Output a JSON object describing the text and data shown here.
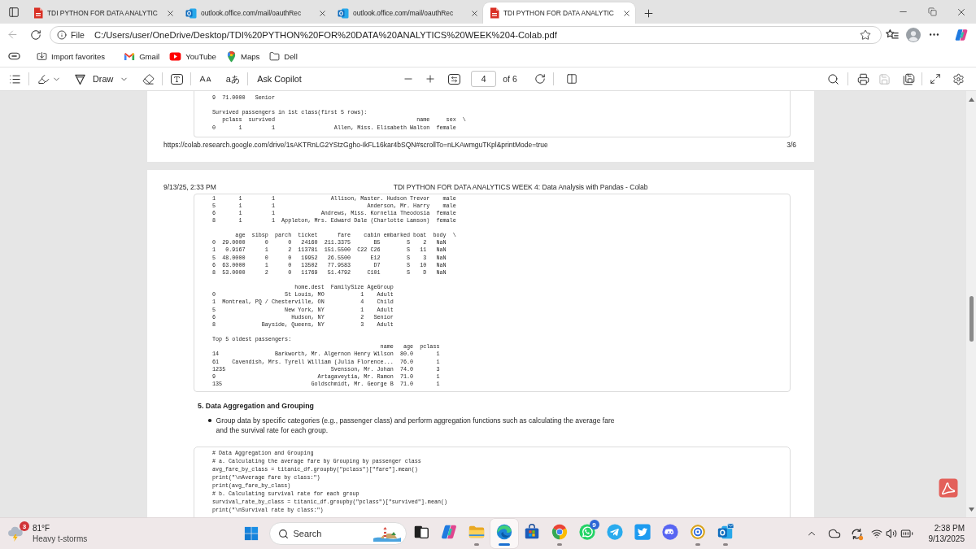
{
  "tabs": [
    {
      "title": "TDI PYTHON FOR DATA ANALYTIC",
      "kind": "pdf",
      "selected": false
    },
    {
      "title": "outlook.office.com/mail/oauthRec",
      "kind": "outlook",
      "selected": false
    },
    {
      "title": "outlook.office.com/mail/oauthRec",
      "kind": "outlook",
      "selected": false
    },
    {
      "title": "TDI PYTHON FOR DATA ANALYTIC",
      "kind": "pdf",
      "selected": true
    }
  ],
  "address_bar": {
    "back_disabled": true,
    "scheme": "File",
    "url": "C:/Users/user/OneDrive/Desktop/TDI%20PYTHON%20FOR%20DATA%20ANALYTICS%20WEEK%204-Colab.pdf"
  },
  "favorites_bar": [
    {
      "label": "Import favorites",
      "kind": "import"
    },
    {
      "label": "Gmail",
      "kind": "gmail"
    },
    {
      "label": "YouTube",
      "kind": "youtube"
    },
    {
      "label": "Maps",
      "kind": "maps"
    },
    {
      "label": "Dell",
      "kind": "folder"
    }
  ],
  "pdf_toolbar": {
    "draw_label": "Draw",
    "translate_glyph": "aあ",
    "ask_copilot": "Ask Copilot",
    "page_number": "4",
    "page_count": "of 6",
    "save_disabled": true
  },
  "document": {
    "page_3": {
      "output_blocks": [
        [
          "9  71.0000   Senior"
        ],
        [
          "Survived passengers in 1st class(first 5 rows):",
          "   pclass  survived                                           name     sex  \\",
          "0       1         1                  Allen, Miss. Elisabeth Walton  female"
        ]
      ],
      "footer_url": "https://colab.research.google.com/drive/1sAKTRnLG2YStzGgho-IkFL16kar4bSQN#scrollTo=nLKAwmguTKpl&printMode=true",
      "footer_page": "3/6"
    },
    "page_4": {
      "header_date": "9/13/25, 2:33 PM",
      "header_title": "TDI PYTHON FOR DATA ANALYTICS WEEK 4: Data Analysis with Pandas - Colab",
      "output_blocks": [
        [
          "1       1         1                 Allison, Master. Hudson Trevor    male",
          "5       1         1                            Anderson, Mr. Harry    male",
          "6       1         1              Andrews, Miss. Kornelia Theodosia  female",
          "8       1         1  Appleton, Mrs. Edward Dale (Charlotte Lamson)  female"
        ],
        [
          "       age  sibsp  parch  ticket      fare    cabin embarked boat  body  \\",
          "0  29.0000      0      0   24160  211.3375       B5        S    2   NaN",
          "1   0.9167      1      2  113781  151.5500  C22 C26        S   11   NaN",
          "5  48.0000      0      0   19952   26.5500      E12        S    3   NaN",
          "6  63.0000      1      0   13502   77.9583       D7        S   10   NaN",
          "8  53.0000      2      0   11769   51.4792     C101        S    D   NaN"
        ],
        [
          "                         home.dest  FamilySize AgeGroup",
          "0                     St Louis, MO           1    Adult",
          "1  Montreal, PQ / Chesterville, ON           4    Child",
          "5                     New York, NY           1    Adult",
          "6                       Hudson, NY           2   Senior",
          "8              Bayside, Queens, NY           3    Adult"
        ],
        [
          "Top 5 oldest passengers:",
          "                                                   name   age  pclass",
          "14                 Barkworth, Mr. Algernon Henry Wilson  80.0       1",
          "61    Cavendish, Mrs. Tyrell William (Julia Florence...  76.0       1",
          "1235                                Svensson, Mr. Johan  74.0       3",
          "9                               Artagaveytia, Mr. Ramon  71.0       1",
          "135                           Goldschmidt, Mr. George B  71.0       1"
        ]
      ],
      "section_heading": "5. Data Aggregation and Grouping",
      "bullets": [
        "Group data by specific categories (e.g., passenger class) and perform aggregation functions such as calculating the average fare and the survival rate for each group."
      ],
      "code_lines": [
        "# Data Aggregation and Grouping",
        "# a. Calculating the average fare by Grouping by passenger class",
        "avg_fare_by_class = titanic_df.groupby(\"pclass\")[\"fare\"].mean()",
        "print(\"\\nAverage fare by class:\")",
        "print(avg_fare_by_class)",
        "# b. Calculating survival rate for each group",
        "survival_rate_by_class = titanic_df.groupby(\"pclass\")[\"survived\"].mean()",
        "print(\"\\nSurvival rate by class:\")"
      ]
    }
  },
  "taskbar": {
    "weather": {
      "alert_count": "3",
      "temperature": "81°F",
      "condition": "Heavy t-storms"
    },
    "search_label": "Search",
    "apps": [
      {
        "kind": "task-view",
        "running": false,
        "active": false
      },
      {
        "kind": "copilot",
        "running": false,
        "active": false
      },
      {
        "kind": "file-explorer",
        "running": true,
        "active": false
      },
      {
        "kind": "edge",
        "running": true,
        "active": true
      },
      {
        "kind": "store",
        "running": false,
        "active": false
      },
      {
        "kind": "chrome",
        "running": true,
        "active": false
      },
      {
        "kind": "whatsapp",
        "running": false,
        "active": false,
        "badge": "9"
      },
      {
        "kind": "telegram",
        "running": false,
        "active": false
      },
      {
        "kind": "twitter",
        "running": false,
        "active": false
      },
      {
        "kind": "discord",
        "running": false,
        "active": false
      },
      {
        "kind": "ring",
        "running": true,
        "active": false
      },
      {
        "kind": "outlook",
        "running": true,
        "active": false
      }
    ],
    "clock": {
      "time": "2:38 PM",
      "date": "9/13/2025"
    }
  }
}
